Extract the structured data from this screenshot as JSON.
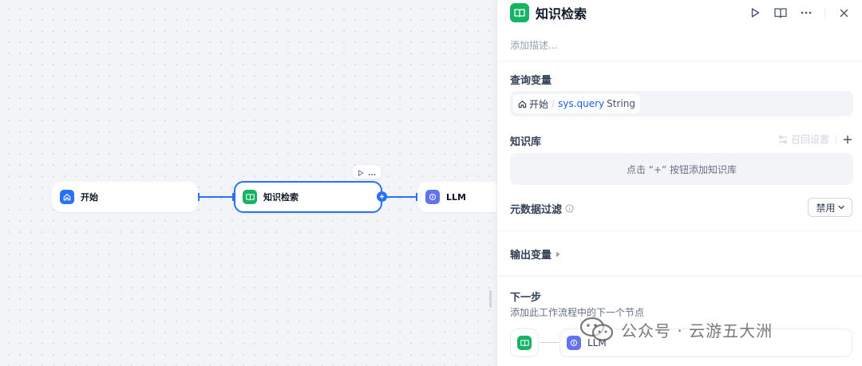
{
  "canvas": {
    "nodes": {
      "start": {
        "label": "开始",
        "icon": "home-icon"
      },
      "knowledge_retrieval": {
        "label": "知识检索",
        "icon": "book-icon"
      },
      "llm": {
        "label": "LLM",
        "icon": "brain-icon"
      }
    }
  },
  "panel": {
    "title": "知识检索",
    "description_placeholder": "添加描述...",
    "query_variable": {
      "title": "查询变量",
      "source": "开始",
      "separator": "/",
      "variable": "sys.query",
      "type": "String"
    },
    "knowledge_base": {
      "title": "知识库",
      "recall_settings": "召回设置",
      "empty_hint": "点击 “+” 按钮添加知识库"
    },
    "metadata_filter": {
      "title": "元数据过滤",
      "value": "禁用"
    },
    "output_variables": {
      "title": "输出变量"
    },
    "next_step": {
      "title": "下一步",
      "description": "添加此工作流程中的下一个节点",
      "target": "LLM"
    }
  },
  "watermark": {
    "text": "公众号 · 云游五大洲"
  },
  "colors": {
    "accent": "#2970ff",
    "kr_icon": "#16b364",
    "llm_icon": "#6172f3"
  }
}
